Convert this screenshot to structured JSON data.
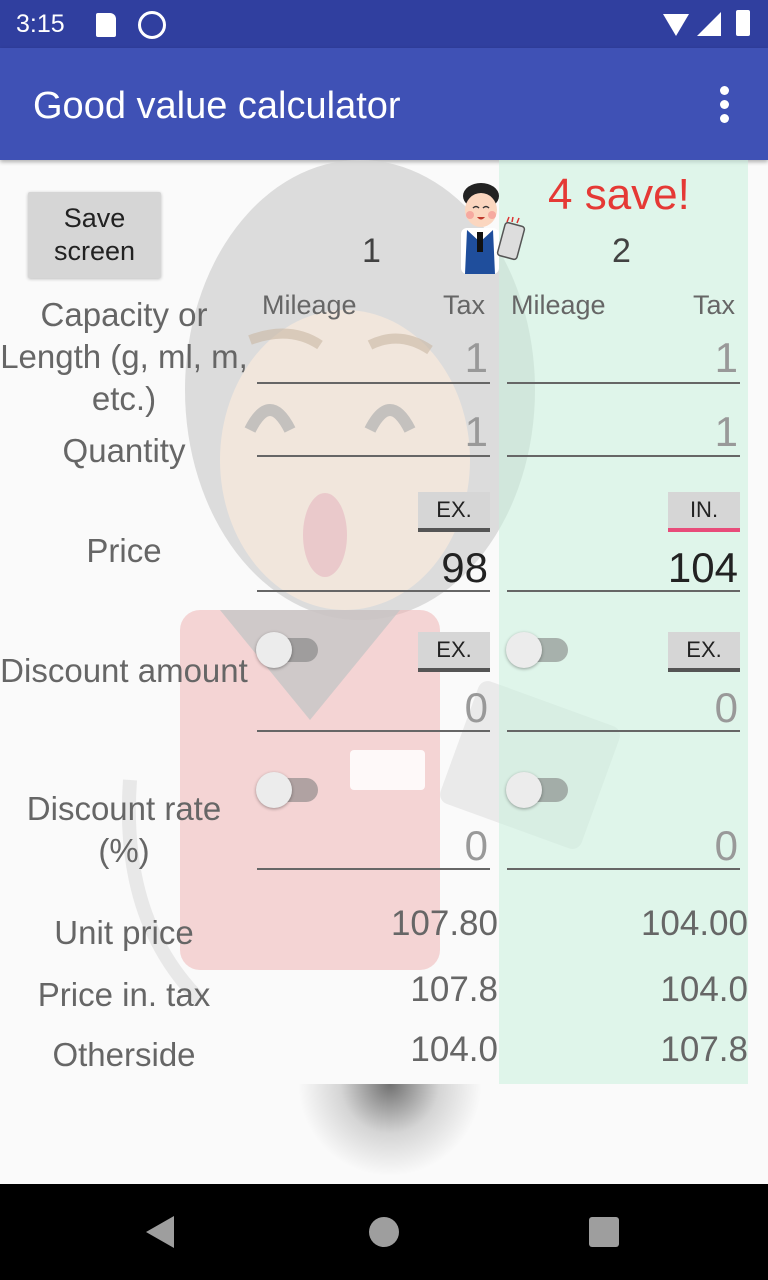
{
  "status_bar": {
    "time": "3:15",
    "icons": [
      "sd-card-icon",
      "vpn-q-icon",
      "wifi-icon",
      "signal-icon",
      "battery-icon"
    ]
  },
  "app_bar": {
    "title": "Good value calculator",
    "menu_icon": "more-vert-icon"
  },
  "header": {
    "save_screen_label": "Save\nscreen",
    "result_banner": "4 save!",
    "columns": [
      {
        "number": "1",
        "mileage_label": "Mileage",
        "tax_label": "Tax"
      },
      {
        "number": "2",
        "mileage_label": "Mileage",
        "tax_label": "Tax"
      }
    ]
  },
  "rows": {
    "capacity": {
      "label": "Capacity or Length (g, ml, m, etc.)",
      "values": [
        "1",
        "1"
      ]
    },
    "quantity": {
      "label": "Quantity",
      "values": [
        "1",
        "1"
      ]
    },
    "price": {
      "label": "Price",
      "values": [
        "98",
        "104"
      ],
      "tax_mode": [
        "EX.",
        "IN."
      ]
    },
    "discount_amount": {
      "label": "Discount amount",
      "values": [
        "0",
        "0"
      ],
      "tax_mode": [
        "EX.",
        "EX."
      ],
      "switch_on": [
        false,
        false
      ]
    },
    "discount_rate": {
      "label": "Discount rate (%)",
      "values": [
        "0",
        "0"
      ],
      "switch_on": [
        false,
        false
      ]
    }
  },
  "results": {
    "unit_price": {
      "label": "Unit price",
      "values": [
        "107.80",
        "104.00"
      ]
    },
    "price_in_tax": {
      "label": "Price in. tax",
      "values": [
        "107.8",
        "104.0"
      ]
    },
    "otherside": {
      "label": "Otherside",
      "values": [
        "104.0",
        "107.8"
      ]
    }
  },
  "colors": {
    "app_bar": "#3f51b5",
    "status_bar": "#303f9f",
    "banner": "#e53935",
    "winner_column": "#d8f3e6",
    "in_tax_accent": "#e84c7a"
  },
  "nav_bar": {
    "buttons": [
      "back",
      "home",
      "recents"
    ]
  }
}
